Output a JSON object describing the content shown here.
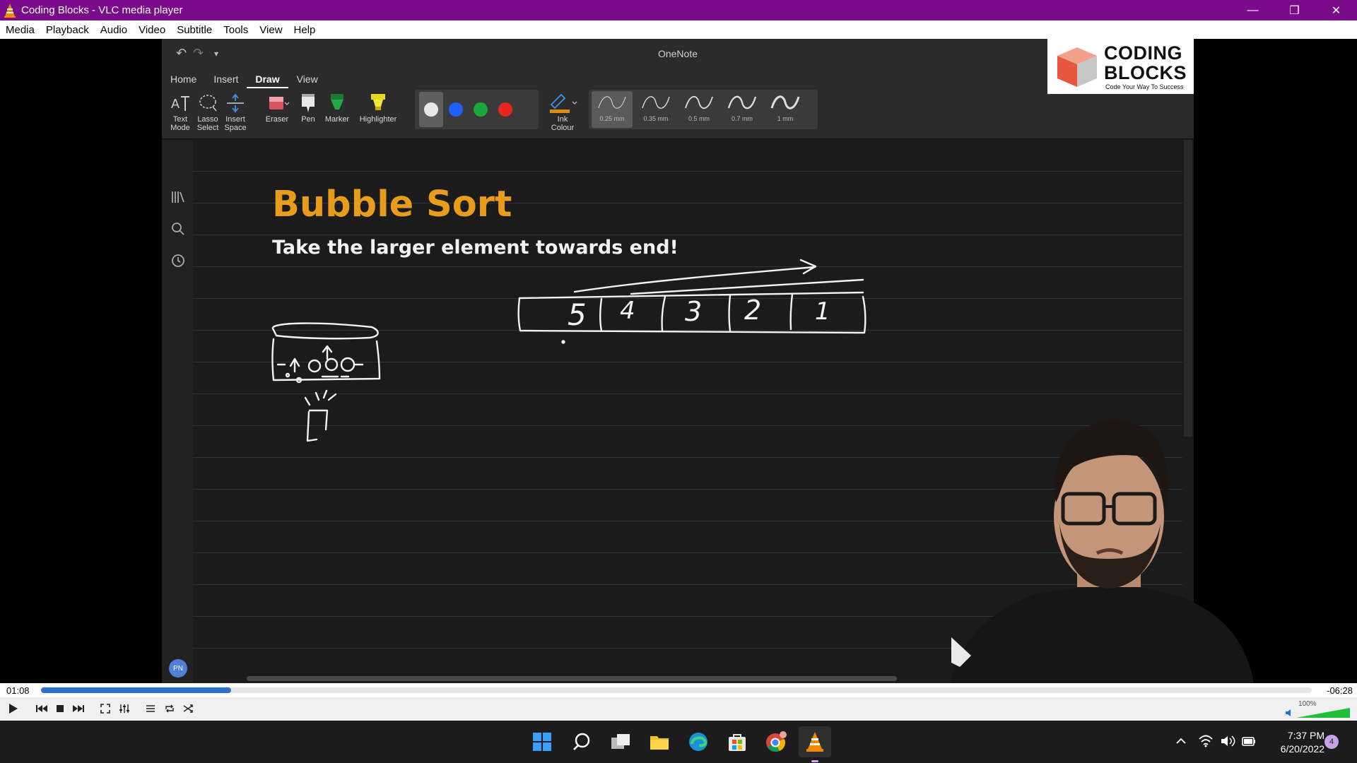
{
  "window": {
    "title": "Coding Blocks - VLC media player",
    "minimize": "—",
    "restore": "❐",
    "close": "✕"
  },
  "menu": [
    "Media",
    "Playback",
    "Audio",
    "Video",
    "Subtitle",
    "Tools",
    "View",
    "Help"
  ],
  "onenote": {
    "app_title": "OneNote",
    "tabs": [
      "Home",
      "Insert",
      "Draw",
      "View"
    ],
    "active_tab": "Draw",
    "tools": {
      "text_mode": "Text\nMode",
      "lasso_select": "Lasso\nSelect",
      "insert_space": "Insert\nSpace",
      "eraser": "Eraser",
      "pen": "Pen",
      "marker": "Marker",
      "highlighter": "Highlighter",
      "ink_colour": "Ink\nColour"
    },
    "colors": [
      "#e8e8e8",
      "#2060ff",
      "#1aa83a",
      "#e8261e"
    ],
    "thickness": [
      "0.25 mm",
      "0.35 mm",
      "0.5 mm",
      "0.7 mm",
      "1 mm"
    ],
    "selected_thickness": "0.25 mm",
    "avatar": "PN",
    "page": {
      "title": "Bubble Sort",
      "subtitle": "Take the larger element towards end!"
    }
  },
  "logo": {
    "line1": "CODING",
    "line2": "BLOCKS",
    "tagline": "Code Your Way To Success"
  },
  "player": {
    "elapsed": "01:08",
    "remaining": "-06:28",
    "progress": 0.1495,
    "volume": "100%",
    "volume_level": 1.0
  },
  "tray": {
    "time": "7:37 PM",
    "date": "6/20/2022",
    "notifications": "4"
  }
}
